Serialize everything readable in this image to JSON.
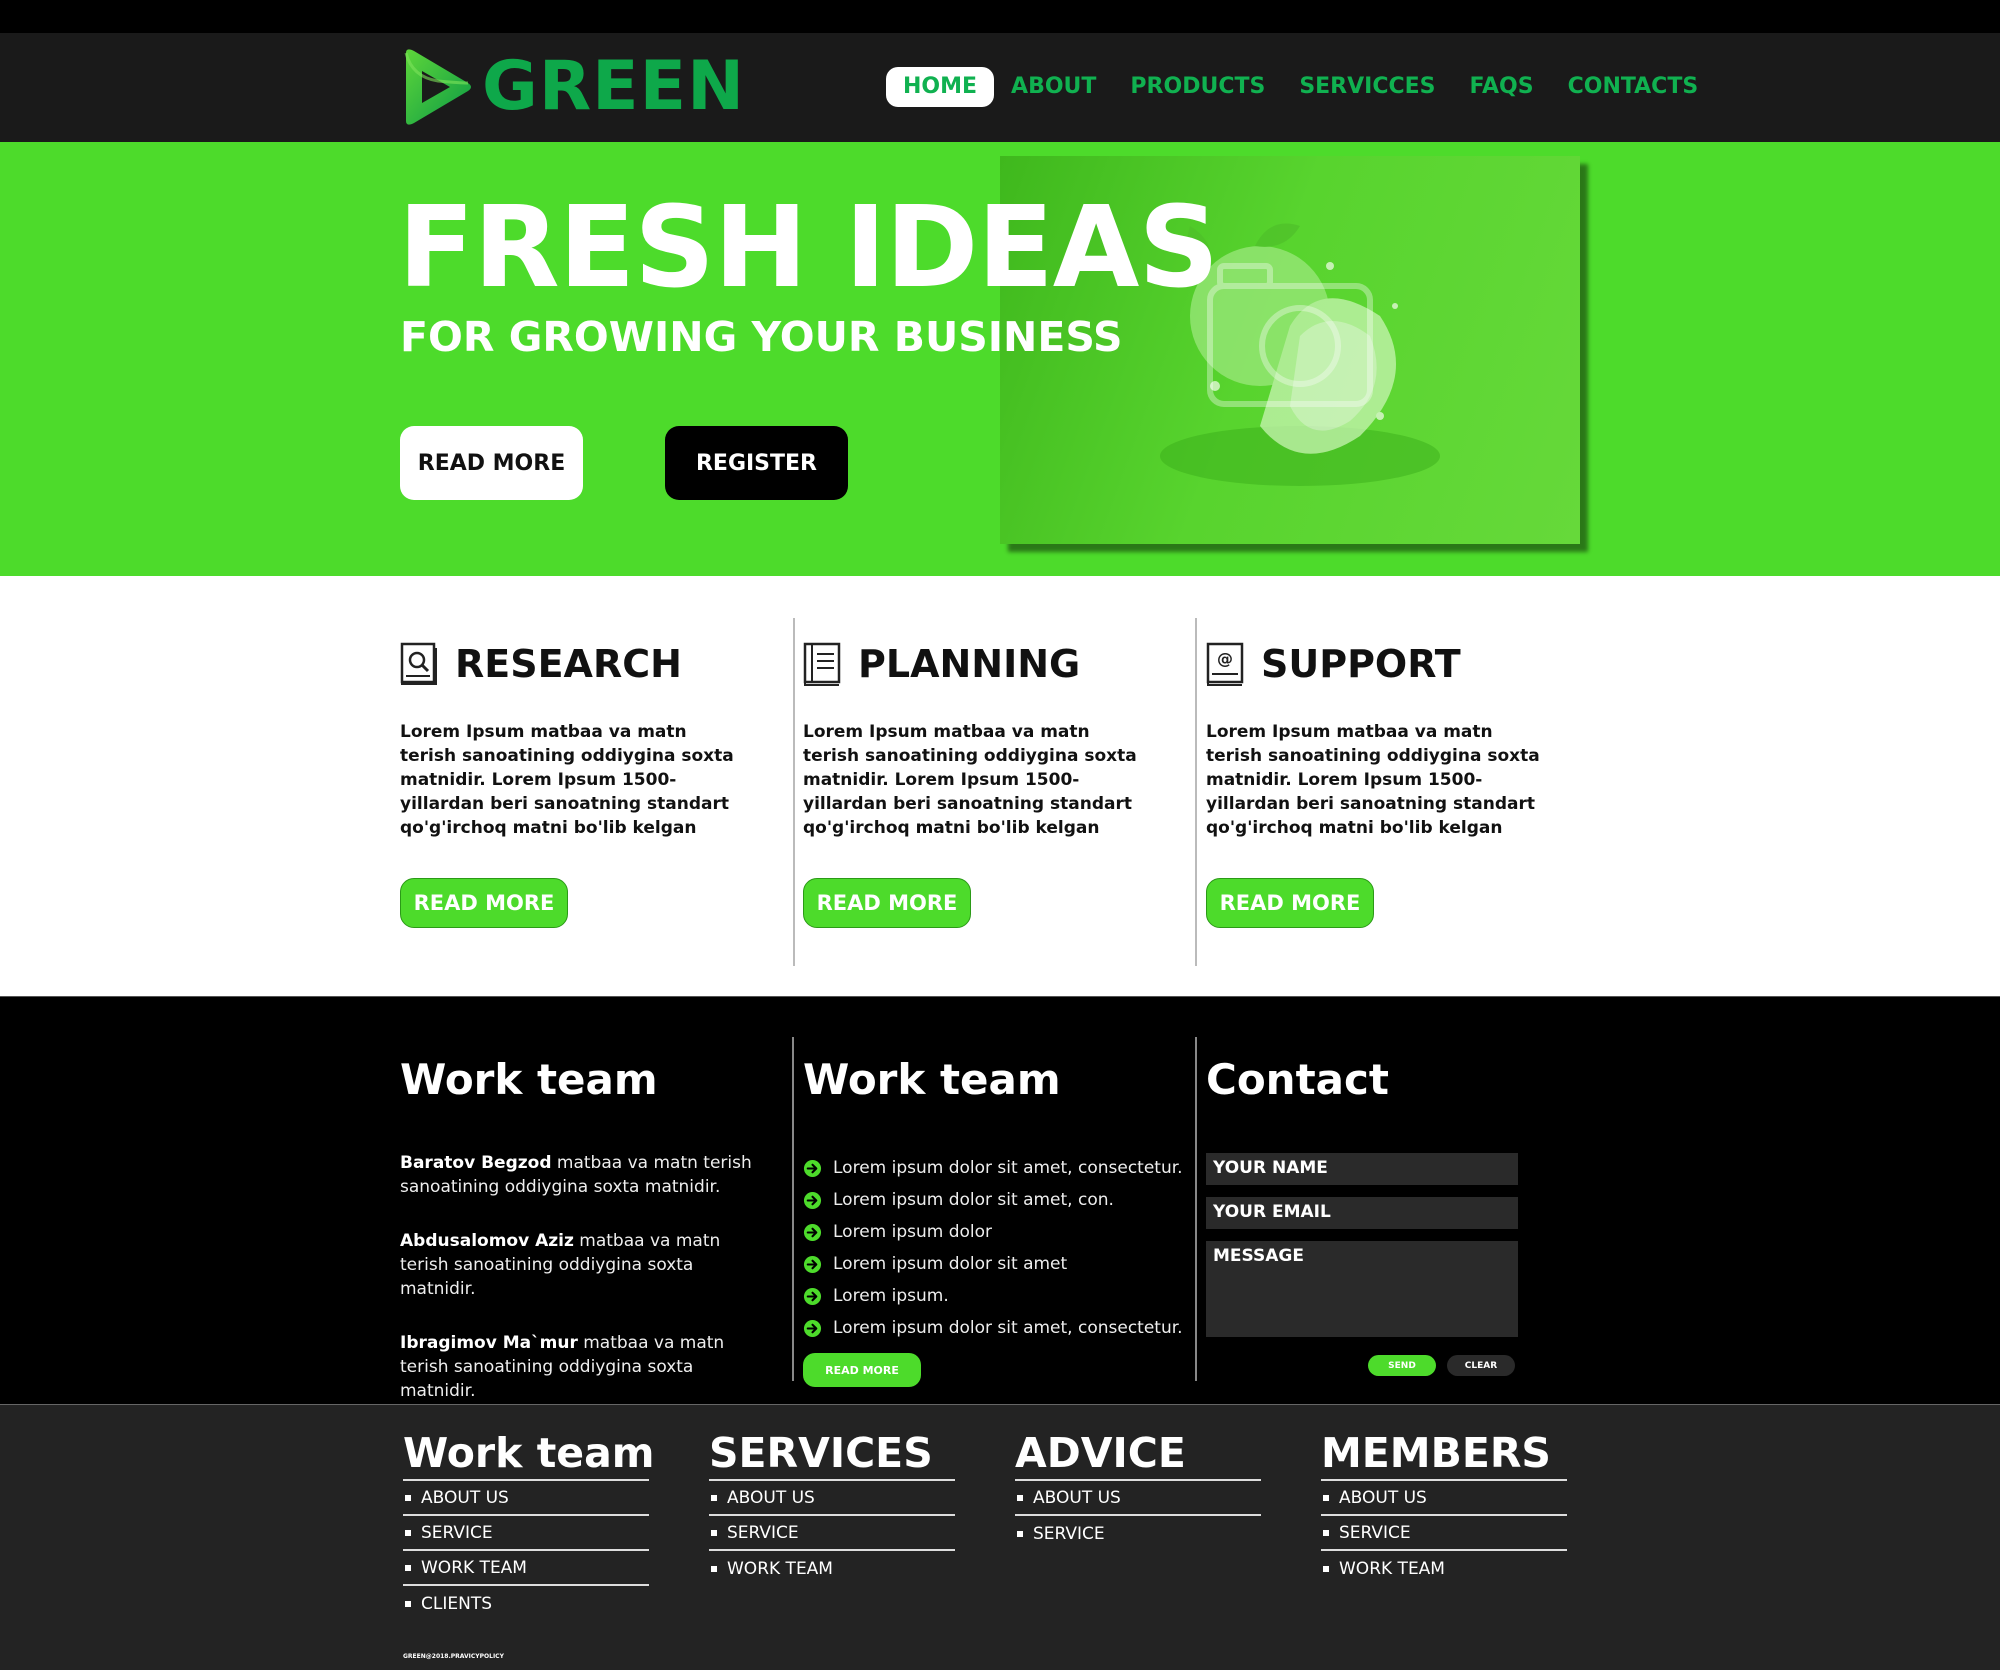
{
  "brand": {
    "name": "GREEN",
    "accent": "#4ddb2b",
    "brand_green": "#10b150"
  },
  "nav": {
    "items": [
      {
        "label": "HOME",
        "active": true
      },
      {
        "label": "ABOUT"
      },
      {
        "label": "PRODUCTS"
      },
      {
        "label": "SERVICCES"
      },
      {
        "label": "FAQS"
      },
      {
        "label": "CONTACTS"
      }
    ]
  },
  "hero": {
    "title": "FRESH IDEAS",
    "subtitle": "FOR GROWING YOUR BUSINESS",
    "read_more": "READ MORE",
    "register": "REGISTER",
    "image_icon": "green-apple-splash"
  },
  "features": [
    {
      "title": "RESEARCH",
      "icon": "search-book-icon",
      "text": "Lorem Ipsum matbaa va matn terish sanoatining oddiygina soxta matnidir. Lorem Ipsum 1500-yillardan beri sanoatning standart qo'g'irchoq matni bo'lib kelgan",
      "button": "READ MORE"
    },
    {
      "title": "PLANNING",
      "icon": "notebook-icon",
      "text": "Lorem Ipsum matbaa va matn terish sanoatining oddiygina soxta matnidir. Lorem Ipsum 1500-yillardan beri sanoatning standart qo'g'irchoq matni bo'lib kelgan",
      "button": "READ MORE"
    },
    {
      "title": "SUPPORT",
      "icon": "address-book-icon",
      "text": "Lorem Ipsum matbaa va matn terish sanoatining oddiygina soxta matnidir. Lorem Ipsum 1500-yillardan beri sanoatning standart qo'g'irchoq matni bo'lib kelgan",
      "button": "READ MORE"
    }
  ],
  "team": {
    "col1_title": "Work team",
    "members": [
      {
        "name": "Baratov Begzod",
        "text": "matbaa va matn terish sanoatining oddiygina soxta matnidir."
      },
      {
        "name": "Abdusalomov Aziz",
        "text": "matbaa va matn terish sanoatining oddiygina soxta matnidir."
      },
      {
        "name": "Ibragimov Ma`mur",
        "text": "matbaa va matn terish sanoatining oddiygina soxta matnidir."
      }
    ],
    "col2_title": "Work team",
    "checklist": [
      "Lorem ipsum dolor sit amet, consectetur.",
      "Lorem ipsum dolor sit amet, con.",
      "Lorem ipsum dolor",
      "Lorem ipsum dolor sit amet",
      "Lorem ipsum.",
      "Lorem ipsum dolor sit amet, consectetur."
    ],
    "col2_button": "READ MORE",
    "contact_title": "Contact",
    "form": {
      "name": "YOUR NAME",
      "email": "YOUR EMAIL",
      "message": "MESSAGE",
      "send": "SEND",
      "clear": "CLEAR"
    }
  },
  "footer": {
    "columns": [
      {
        "title": "Work team",
        "links": [
          "ABOUT US",
          "SERVICE",
          "WORK TEAM",
          "CLIENTS"
        ]
      },
      {
        "title": "SERVICES",
        "links": [
          "ABOUT US",
          "SERVICE",
          "WORK TEAM"
        ]
      },
      {
        "title": "ADVICE",
        "links": [
          "ABOUT US",
          "SERVICE"
        ]
      },
      {
        "title": "MEMBERS",
        "links": [
          "ABOUT US",
          "SERVICE",
          "WORK TEAM"
        ]
      }
    ],
    "copyright": "GREEN@2018.PRAVICYPOLICY"
  }
}
